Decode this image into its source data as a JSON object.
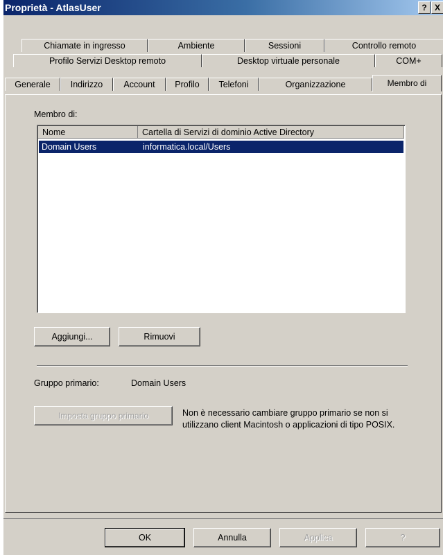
{
  "window": {
    "title": "Proprietà - AtlasUser",
    "help_label": "?",
    "close_label": "X"
  },
  "tabs": {
    "row1": [
      "Chiamate in ingresso",
      "Ambiente",
      "Sessioni",
      "Controllo remoto"
    ],
    "row2": [
      "Profilo Servizi Desktop remoto",
      "Desktop virtuale personale",
      "COM+"
    ],
    "row3": [
      "Generale",
      "Indirizzo",
      "Account",
      "Profilo",
      "Telefoni",
      "Organizzazione",
      "Membro di"
    ],
    "active": "Membro di"
  },
  "member_of": {
    "label": "Membro di:",
    "columns": [
      "Nome",
      "Cartella di Servizi di dominio Active Directory"
    ],
    "rows": [
      {
        "name": "Domain Users",
        "folder": "informatica.local/Users",
        "selected": true
      }
    ],
    "add_label": "Aggiungi...",
    "remove_label": "Rimuovi"
  },
  "primary_group": {
    "label": "Gruppo primario:",
    "value": "Domain Users",
    "set_button_label": "Imposta gruppo primario",
    "set_button_enabled": false,
    "note": "Non è necessario cambiare gruppo primario se non si utilizzano client Macintosh o applicazioni di tipo POSIX."
  },
  "footer": {
    "ok_label": "OK",
    "cancel_label": "Annulla",
    "apply_label": "Applica",
    "apply_enabled": false,
    "help_label": "?"
  },
  "colors": {
    "dialog_face": "#d4d0c8",
    "selection": "#0a246a",
    "titlebar_start": "#0a246a",
    "titlebar_end": "#a6caf0"
  }
}
